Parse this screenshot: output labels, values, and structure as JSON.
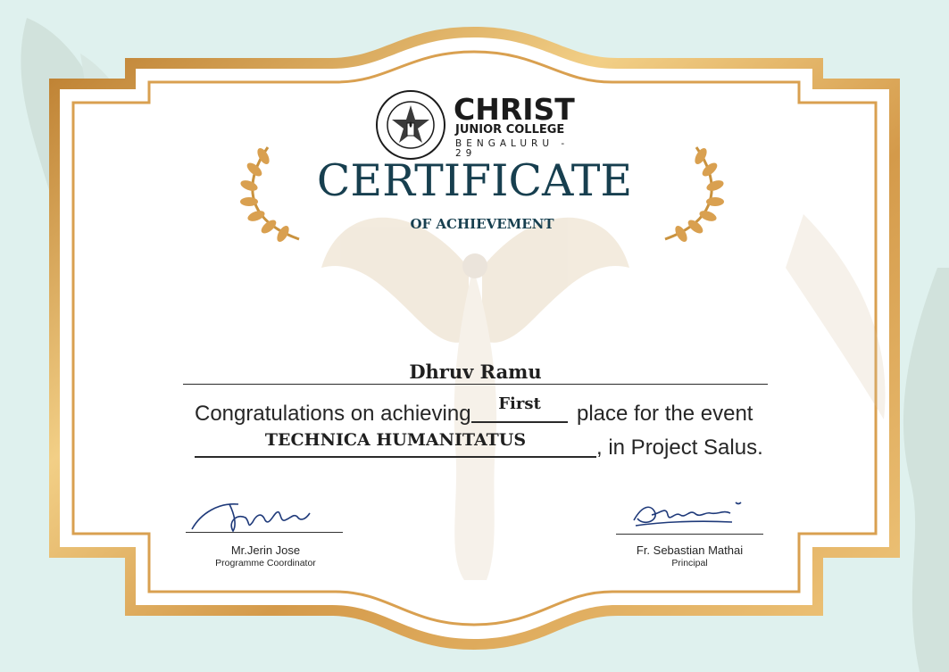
{
  "colors": {
    "gold": "#d9a050",
    "gold_light": "#f0cf8c",
    "teal_bg": "#dff1ee",
    "title": "#173f4f"
  },
  "logo": {
    "seal_icon": "college-seal-icon",
    "name": "CHRIST",
    "sub": "JUNIOR COLLEGE",
    "city": "BENGALURU - 29"
  },
  "certificate": {
    "title": "CERTIFICATE",
    "subtitle": "OF ACHIEVEMENT",
    "recipient": "Dhruv Ramu",
    "line1_prefix": "Congratulations on achieving",
    "placement": "First",
    "line1_suffix": "place for the event",
    "event": "TECHNICA HUMANITATUS",
    "line2_suffix": ", in Project Salus."
  },
  "signatories": [
    {
      "name": "Mr.Jerin Jose",
      "role": "Programme Coordinator"
    },
    {
      "name": "Fr. Sebastian Mathai",
      "role": "Principal"
    }
  ],
  "icons": [
    "laurel-left-icon",
    "laurel-right-icon",
    "angel-watermark-icon"
  ]
}
